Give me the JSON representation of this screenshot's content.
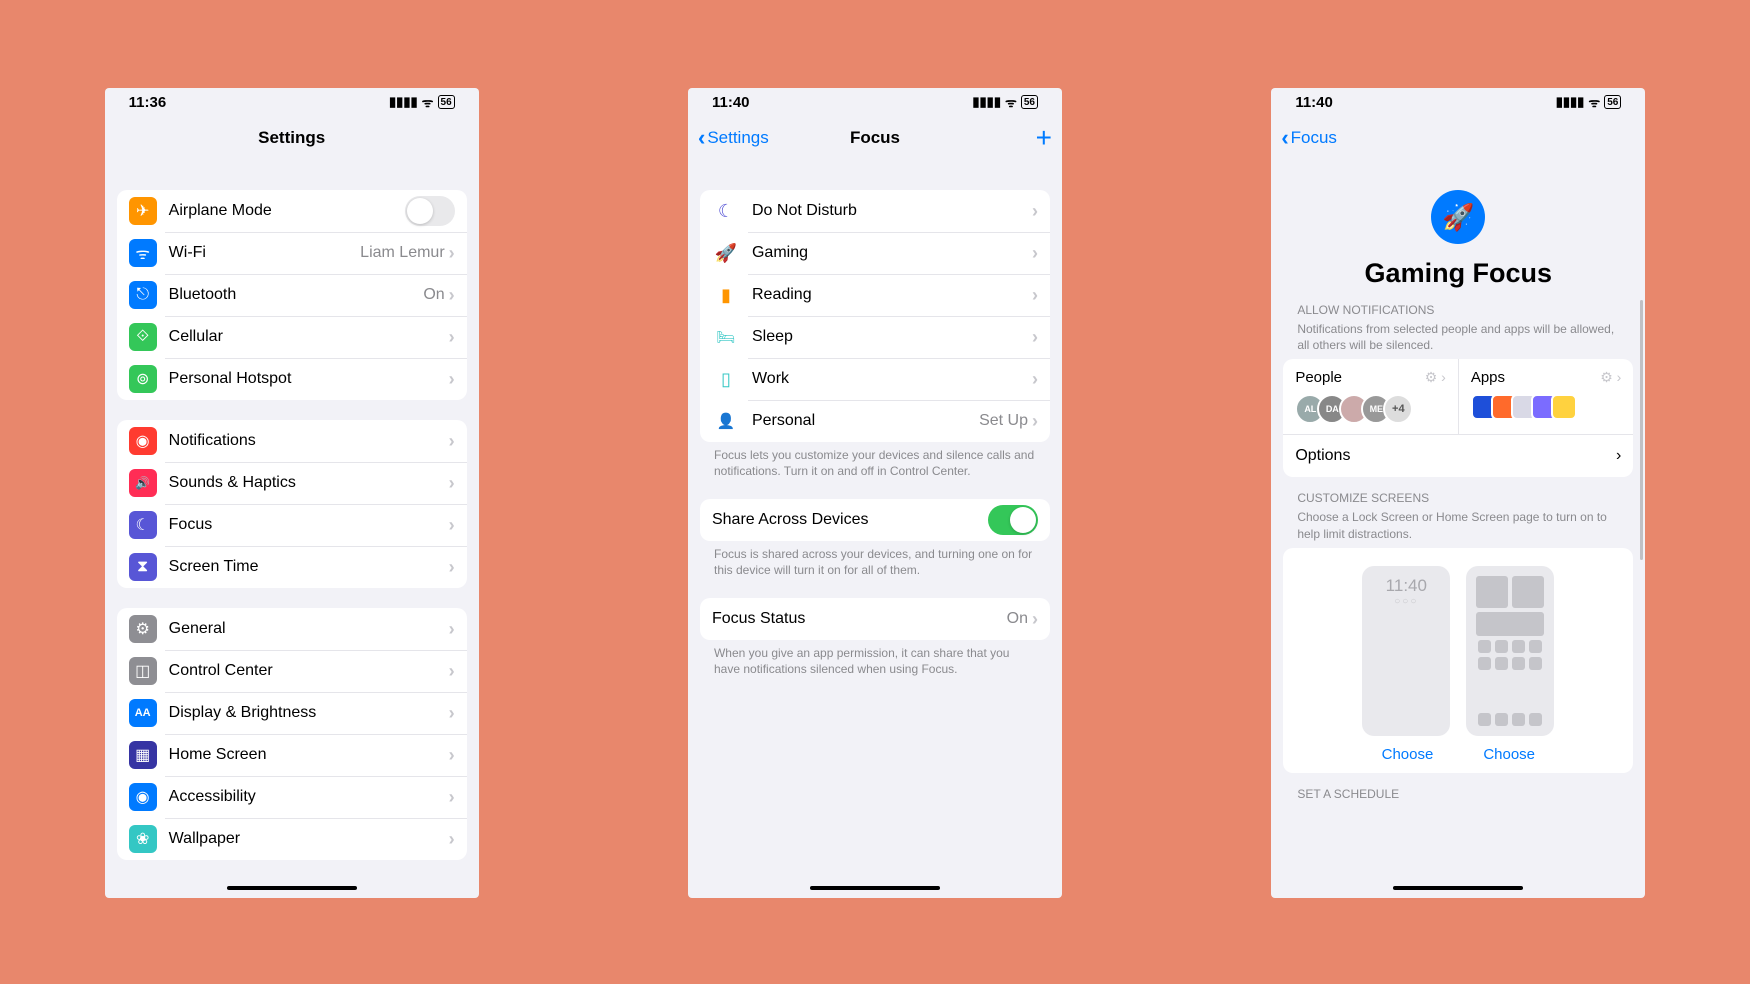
{
  "status": {
    "time1": "11:36",
    "time2": "11:40",
    "time3": "11:40",
    "battery": "56"
  },
  "p1": {
    "title": "Settings",
    "g1": [
      {
        "label": "Airplane Mode",
        "icon_bg": "#ff9500",
        "glyph": "✈",
        "toggle": false
      },
      {
        "label": "Wi-Fi",
        "icon_bg": "#007aff",
        "glyph": "ᯤ",
        "value": "Liam Lemur"
      },
      {
        "label": "Bluetooth",
        "icon_bg": "#007aff",
        "glyph": "⌽",
        "value": "On"
      },
      {
        "label": "Cellular",
        "icon_bg": "#34c759",
        "glyph": "⟐"
      },
      {
        "label": "Personal Hotspot",
        "icon_bg": "#34c759",
        "glyph": "⊕"
      }
    ],
    "g2": [
      {
        "label": "Notifications",
        "icon_bg": "#ff3b30",
        "glyph": "◉"
      },
      {
        "label": "Sounds & Haptics",
        "icon_bg": "#ff2d55",
        "glyph": "🔊"
      },
      {
        "label": "Focus",
        "icon_bg": "#5856d6",
        "glyph": "☾"
      },
      {
        "label": "Screen Time",
        "icon_bg": "#5856d6",
        "glyph": "⧗"
      }
    ],
    "g3": [
      {
        "label": "General",
        "icon_bg": "#8e8e93",
        "glyph": "⚙"
      },
      {
        "label": "Control Center",
        "icon_bg": "#8e8e93",
        "glyph": "◫"
      },
      {
        "label": "Display & Brightness",
        "icon_bg": "#007aff",
        "glyph": "AA"
      },
      {
        "label": "Home Screen",
        "icon_bg": "#3634a3",
        "glyph": "▦"
      },
      {
        "label": "Accessibility",
        "icon_bg": "#007aff",
        "glyph": "◉"
      },
      {
        "label": "Wallpaper",
        "icon_bg": "#34c7c4",
        "glyph": "❀"
      }
    ]
  },
  "p2": {
    "back": "Settings",
    "title": "Focus",
    "modes": [
      {
        "label": "Do Not Disturb",
        "color": "#5856d6",
        "glyph": "☾"
      },
      {
        "label": "Gaming",
        "color": "#007aff",
        "glyph": "🚀"
      },
      {
        "label": "Reading",
        "color": "#ff9500",
        "glyph": "▮"
      },
      {
        "label": "Sleep",
        "color": "#34c7c4",
        "glyph": "🛏"
      },
      {
        "label": "Work",
        "color": "#34c7c4",
        "glyph": "▯"
      },
      {
        "label": "Personal",
        "color": "#af52de",
        "glyph": "👤",
        "value": "Set Up"
      }
    ],
    "footer1": "Focus lets you customize your devices and silence calls and notifications. Turn it on and off in Control Center.",
    "share": {
      "label": "Share Across Devices",
      "on": true
    },
    "footer2": "Focus is shared across your devices, and turning one on for this device will turn it on for all of them.",
    "status": {
      "label": "Focus Status",
      "value": "On"
    },
    "footer3": "When you give an app permission, it can share that you have notifications silenced when using Focus."
  },
  "p3": {
    "back": "Focus",
    "hero": "Gaming Focus",
    "allow_h": "ALLOW NOTIFICATIONS",
    "allow_s": "Notifications from selected people and apps will be allowed, all others will be silenced.",
    "people": "People",
    "apps": "Apps",
    "plus": "+4",
    "options": "Options",
    "cust_h": "CUSTOMIZE SCREENS",
    "cust_s": "Choose a Lock Screen or Home Screen page to turn on to help limit distractions.",
    "mock_time": "11:40",
    "choose": "Choose",
    "sched_h": "SET A SCHEDULE"
  }
}
